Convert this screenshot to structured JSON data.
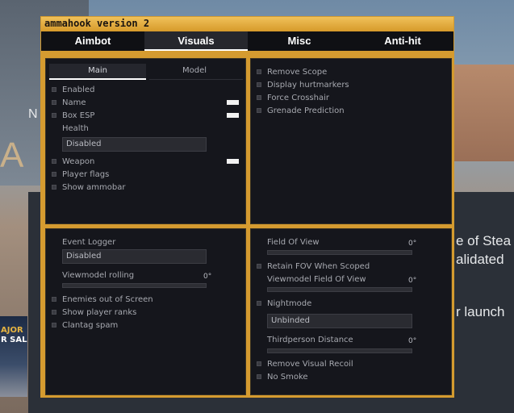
{
  "background": {
    "text_ne": "N",
    "text_a": "A",
    "text_line1": "e of Stea",
    "text_line2": "alidated",
    "text_line3": "r launch",
    "promo_line1": "AJOR",
    "promo_line2": "R SAL"
  },
  "window": {
    "title": "ammahook version 2"
  },
  "tabs": [
    {
      "label": "Aimbot",
      "active": false
    },
    {
      "label": "Visuals",
      "active": true
    },
    {
      "label": "Misc",
      "active": false
    },
    {
      "label": "Anti-hit",
      "active": false
    }
  ],
  "esp_panel": {
    "subtabs": [
      {
        "label": "Main",
        "active": true
      },
      {
        "label": "Model",
        "active": false
      }
    ],
    "enabled": "Enabled",
    "name": "Name",
    "box_esp": "Box ESP",
    "health": "Health",
    "health_mode": "Disabled",
    "weapon": "Weapon",
    "player_flags": "Player flags",
    "show_ammobar": "Show ammobar",
    "color_swatch": "#f2f2f2"
  },
  "misc_panel": {
    "remove_scope": "Remove Scope",
    "display_hurtmarkers": "Display hurtmarkers",
    "force_crosshair": "Force Crosshair",
    "grenade_prediction": "Grenade Prediction"
  },
  "logger_panel": {
    "event_logger": "Event Logger",
    "event_logger_mode": "Disabled",
    "viewmodel_rolling": "Viewmodel rolling",
    "viewmodel_rolling_value": "0°",
    "enemies_out_of_screen": "Enemies out of Screen",
    "show_player_ranks": "Show player ranks",
    "clantag_spam": "Clantag spam"
  },
  "view_panel": {
    "field_of_view": "Field Of View",
    "field_of_view_value": "0°",
    "retain_fov": "Retain FOV When Scoped",
    "viewmodel_fov": "Viewmodel Field Of View",
    "viewmodel_fov_value": "0°",
    "nightmode": "Nightmode",
    "nightmode_key": "Unbinded",
    "thirdperson_distance": "Thirdperson Distance",
    "thirdperson_distance_value": "0°",
    "remove_visual_recoil": "Remove Visual Recoil",
    "no_smoke": "No Smoke"
  },
  "colors": {
    "accent": "#d59b30",
    "panel_bg": "#15161c",
    "text": "#a7a9b0"
  }
}
